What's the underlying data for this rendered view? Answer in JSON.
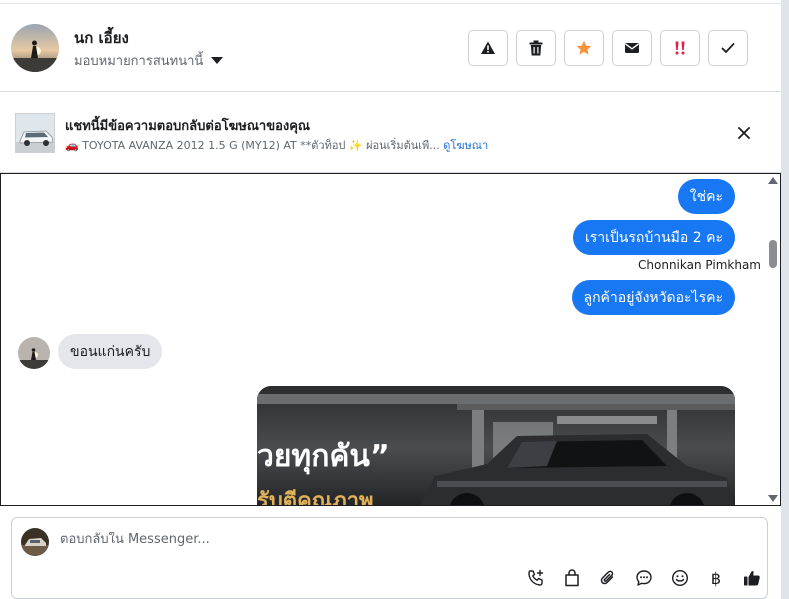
{
  "header": {
    "user_name": "นก เอี้ยง",
    "assign_label": "มอบหมายการสนทนานี้",
    "actions": [
      {
        "name": "spam-button",
        "icon": "warning-icon"
      },
      {
        "name": "delete-button",
        "icon": "trash-icon"
      },
      {
        "name": "star-button",
        "icon": "star-icon",
        "color": "#f7923b"
      },
      {
        "name": "mark-unread-button",
        "icon": "envelope-icon"
      },
      {
        "name": "follow-up-button",
        "icon": "double-exclamation-icon",
        "color": "#e41e3f"
      },
      {
        "name": "done-button",
        "icon": "checkmark-icon"
      }
    ]
  },
  "ad": {
    "title": "แชทนี้มีข้อความตอบกลับต่อโฆษณาของคุณ",
    "subtitle": "🚗 TOYOTA AVANZA 2012 1.5 G (MY12) AT **ตัวท็อป ✨ ผ่อนเริ่มต้นเพี...",
    "link": "ดูโฆษณา"
  },
  "messages": {
    "out_1": "ใช่คะ",
    "out_2": "เราเป็นรถบ้านมือ 2 คะ",
    "sender": "Chonnikan Pimkham",
    "out_3": "ลูกค้าอยู่จังหวัดอะไรคะ",
    "in_1": "ขอนแก่นครับ",
    "photo_text_1": "วยทุกคัน”",
    "photo_text_2": "รับตีคุณภาพ"
  },
  "composer": {
    "placeholder": "ตอบกลับใน Messenger...",
    "baht_symbol": "฿"
  },
  "colors": {
    "brand_blue": "#1877f2",
    "incoming_bubble": "#e4e6eb",
    "link": "#216fdb"
  }
}
